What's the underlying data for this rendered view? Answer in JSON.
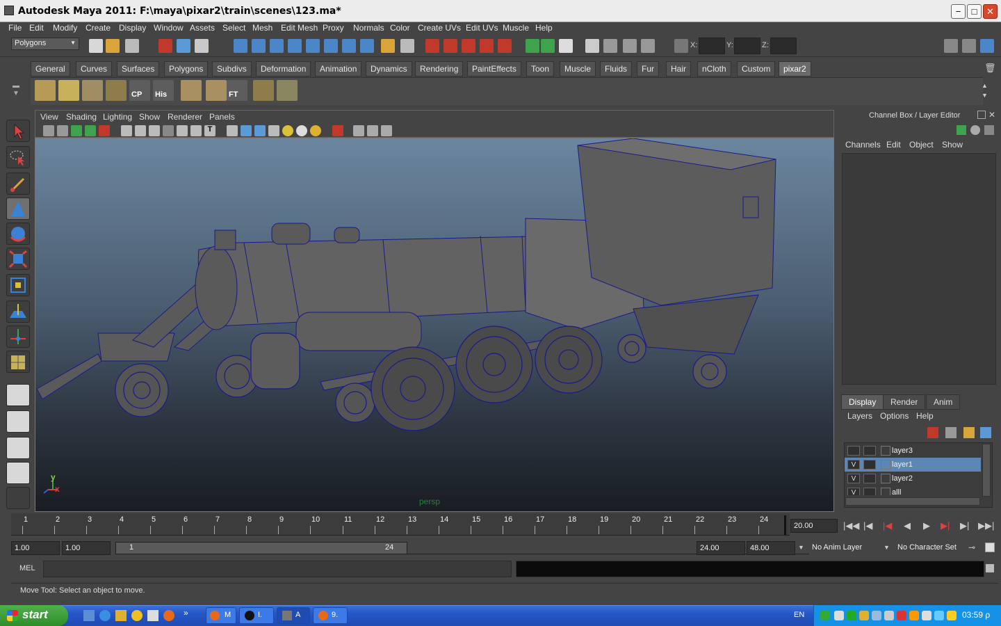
{
  "window": {
    "title": "Autodesk Maya 2011: F:\\maya\\pixar2\\train\\scenes\\123.ma*",
    "minimize": "−",
    "maximize": "□",
    "close": "✕"
  },
  "menu": [
    "File",
    "Edit",
    "Modify",
    "Create",
    "Display",
    "Window",
    "Assets",
    "Select",
    "Mesh",
    "Edit Mesh",
    "Proxy",
    "Normals",
    "Color",
    "Create UVs",
    "Edit UVs",
    "Muscle",
    "Help"
  ],
  "statusline": {
    "mode_select": "Polygons",
    "x_label": "X:",
    "y_label": "Y:",
    "z_label": "Z:"
  },
  "shelf_tabs": [
    "General",
    "Curves",
    "Surfaces",
    "Polygons",
    "Subdivs",
    "Deformation",
    "Animation",
    "Dynamics",
    "Rendering",
    "PaintEffects",
    "Toon",
    "Muscle",
    "Fluids",
    "Fur",
    "Hair",
    "nCloth",
    "Custom",
    "pixar2"
  ],
  "active_shelf": "pixar2",
  "shelf_icons": [
    {
      "name": "poly-plane-icon",
      "label": ""
    },
    {
      "name": "uv-layout-icon",
      "label": ""
    },
    {
      "name": "extrude-icon",
      "label": ""
    },
    {
      "name": "grid-select-icon",
      "label": ""
    },
    {
      "name": "center-pivot-icon",
      "label": "CP"
    },
    {
      "name": "history-icon",
      "label": "His"
    },
    {
      "name": "cube-icon",
      "label": ""
    },
    {
      "name": "cylinder-icon",
      "label": ""
    },
    {
      "name": "freeze-transform-icon",
      "label": "FT"
    },
    {
      "name": "layer-stack-icon",
      "label": ""
    },
    {
      "name": "brush-icon",
      "label": ""
    }
  ],
  "panel_menu": [
    "View",
    "Shading",
    "Lighting",
    "Show",
    "Renderer",
    "Panels"
  ],
  "viewport": {
    "camera_label": "persp",
    "axis_y": "y",
    "axis_x": "x"
  },
  "right_panel": {
    "title": "Channel Box / Layer Editor",
    "menu": [
      "Channels",
      "Edit",
      "Object",
      "Show"
    ],
    "tabs": [
      "Display",
      "Render",
      "Anim"
    ],
    "active_tab": "Display",
    "layer_menu": [
      "Layers",
      "Options",
      "Help"
    ],
    "layers": [
      {
        "name": "layer3",
        "v": "",
        "p": "",
        "selected": false
      },
      {
        "name": "layer1",
        "v": "V",
        "p": "",
        "selected": true
      },
      {
        "name": "layer2",
        "v": "V",
        "p": "",
        "selected": false
      },
      {
        "name": "alll",
        "v": "V",
        "p": "",
        "selected": false
      }
    ]
  },
  "timeline": {
    "ticks": [
      "1",
      "2",
      "3",
      "4",
      "5",
      "6",
      "7",
      "8",
      "9",
      "10",
      "11",
      "12",
      "13",
      "14",
      "15",
      "16",
      "17",
      "18",
      "19",
      "20",
      "21",
      "22",
      "23",
      "24"
    ],
    "current_time": "20.00"
  },
  "range": {
    "start": "1.00",
    "playback_start": "1.00",
    "slider_start": "1",
    "slider_end": "24",
    "playback_end": "24.00",
    "end": "48.00",
    "anim_layer": "No Anim Layer",
    "character_set": "No Character Set"
  },
  "command_line": {
    "label": "MEL"
  },
  "help_line": "Move Tool: Select an object to move.",
  "taskbar": {
    "start": "start",
    "buttons": [
      "M",
      "I.",
      "A",
      "9."
    ],
    "lang": "EN",
    "clock": "03:59 ρ"
  },
  "colors": {
    "accent_selected": "#5c86b4",
    "viewport_top": "#6b86a0",
    "viewport_bottom": "#1a1d22",
    "wireframe": "#1a1a8a"
  }
}
